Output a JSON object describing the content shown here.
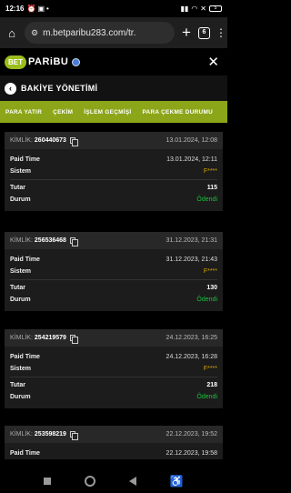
{
  "status": {
    "time": "12:16",
    "battery": "5"
  },
  "browser": {
    "url": "m.betparibu283.com/tr.",
    "tabs_count": "6"
  },
  "site": {
    "logo_badge": "BET",
    "logo_text": "PARiBU"
  },
  "page": {
    "title": "BAKİYE YÖNETİMİ"
  },
  "tabs": [
    "PARA YATIR",
    "ÇEKİM",
    "İŞLEM GEÇMİŞİ",
    "PARA ÇEKME DURUMU"
  ],
  "labels": {
    "kimlik": "KİMLİK:",
    "paid_time": "Paid Time",
    "sistem": "Sistem",
    "tutar": "Tutar",
    "durum": "Durum"
  },
  "transactions": [
    {
      "id": "260440673",
      "date": "13.01.2024, 12:08",
      "paid_time": "13.01.2024, 12:11",
      "sistem": "F****",
      "tutar": "115",
      "durum": "Ödendi"
    },
    {
      "id": "256536468",
      "date": "31.12.2023, 21:31",
      "paid_time": "31.12.2023, 21:43",
      "sistem": "F****",
      "tutar": "130",
      "durum": "Ödendi"
    },
    {
      "id": "254219579",
      "date": "24.12.2023, 16:25",
      "paid_time": "24.12.2023, 16:28",
      "sistem": "F****",
      "tutar": "218",
      "durum": "Ödendi"
    },
    {
      "id": "253598219",
      "date": "22.12.2023, 19:52",
      "paid_time": "22.12.2023, 19:58"
    }
  ]
}
